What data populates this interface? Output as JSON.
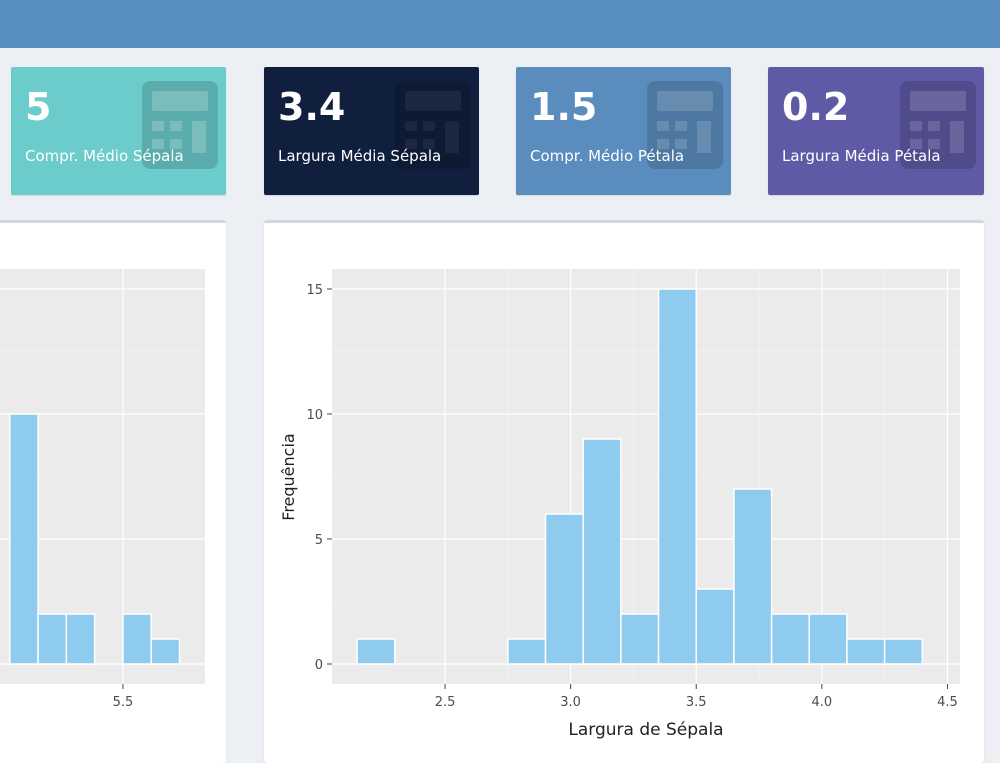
{
  "value_boxes": [
    {
      "value": "5",
      "label": "Compr. Médio Sépala",
      "color": "#6ccbcb",
      "icon": "calculator-icon"
    },
    {
      "value": "3.4",
      "label": "Largura Média Sépala",
      "color": "#0f1f3d",
      "icon": "calculator-icon"
    },
    {
      "value": "1.5",
      "label": "Compr. Médio Pétala",
      "color": "#5a8dbe",
      "icon": "calculator-icon"
    },
    {
      "value": "0.2",
      "label": "Largura Média Pétala",
      "color": "#5f5aa5",
      "icon": "calculator-icon"
    }
  ],
  "colors": {
    "header": "#578ebe",
    "bar_fill": "#8fcbee",
    "plot_bg": "#ebebeb"
  },
  "chart_data": [
    {
      "type": "bar",
      "xlabel": "Largura de Sépala",
      "ylabel": "Frequência",
      "xlim": [
        2.05,
        4.55
      ],
      "ylim": [
        -0.8,
        15.8
      ],
      "x_ticks": [
        2.5,
        3.0,
        3.5,
        4.0,
        4.5
      ],
      "x_tick_labels": [
        "2.5",
        "3.0",
        "3.5",
        "4.0",
        "4.5"
      ],
      "y_ticks": [
        0,
        5,
        10,
        15
      ],
      "y_tick_labels": [
        "0",
        "5",
        "10",
        "15"
      ],
      "bins": [
        {
          "x0": 2.15,
          "x1": 2.3,
          "count": 1
        },
        {
          "x0": 2.75,
          "x1": 2.9,
          "count": 1
        },
        {
          "x0": 2.9,
          "x1": 3.05,
          "count": 6
        },
        {
          "x0": 3.05,
          "x1": 3.2,
          "count": 9
        },
        {
          "x0": 3.2,
          "x1": 3.35,
          "count": 2
        },
        {
          "x0": 3.35,
          "x1": 3.5,
          "count": 15
        },
        {
          "x0": 3.5,
          "x1": 3.65,
          "count": 3
        },
        {
          "x0": 3.65,
          "x1": 3.8,
          "count": 7
        },
        {
          "x0": 3.8,
          "x1": 3.95,
          "count": 2
        },
        {
          "x0": 3.95,
          "x1": 4.1,
          "count": 2
        },
        {
          "x0": 4.1,
          "x1": 4.25,
          "count": 1
        },
        {
          "x0": 4.25,
          "x1": 4.4,
          "count": 1
        }
      ]
    },
    {
      "type": "bar",
      "x_ticks": [
        5.5
      ],
      "x_tick_labels": [
        "5.5"
      ],
      "bins": [
        {
          "x0": 5.1,
          "x1": 5.2,
          "count": 10
        },
        {
          "x0": 5.2,
          "x1": 5.3,
          "count": 2
        },
        {
          "x0": 5.3,
          "x1": 5.4,
          "count": 2
        },
        {
          "x0": 5.5,
          "x1": 5.6,
          "count": 2
        },
        {
          "x0": 5.6,
          "x1": 5.7,
          "count": 1
        }
      ]
    }
  ]
}
